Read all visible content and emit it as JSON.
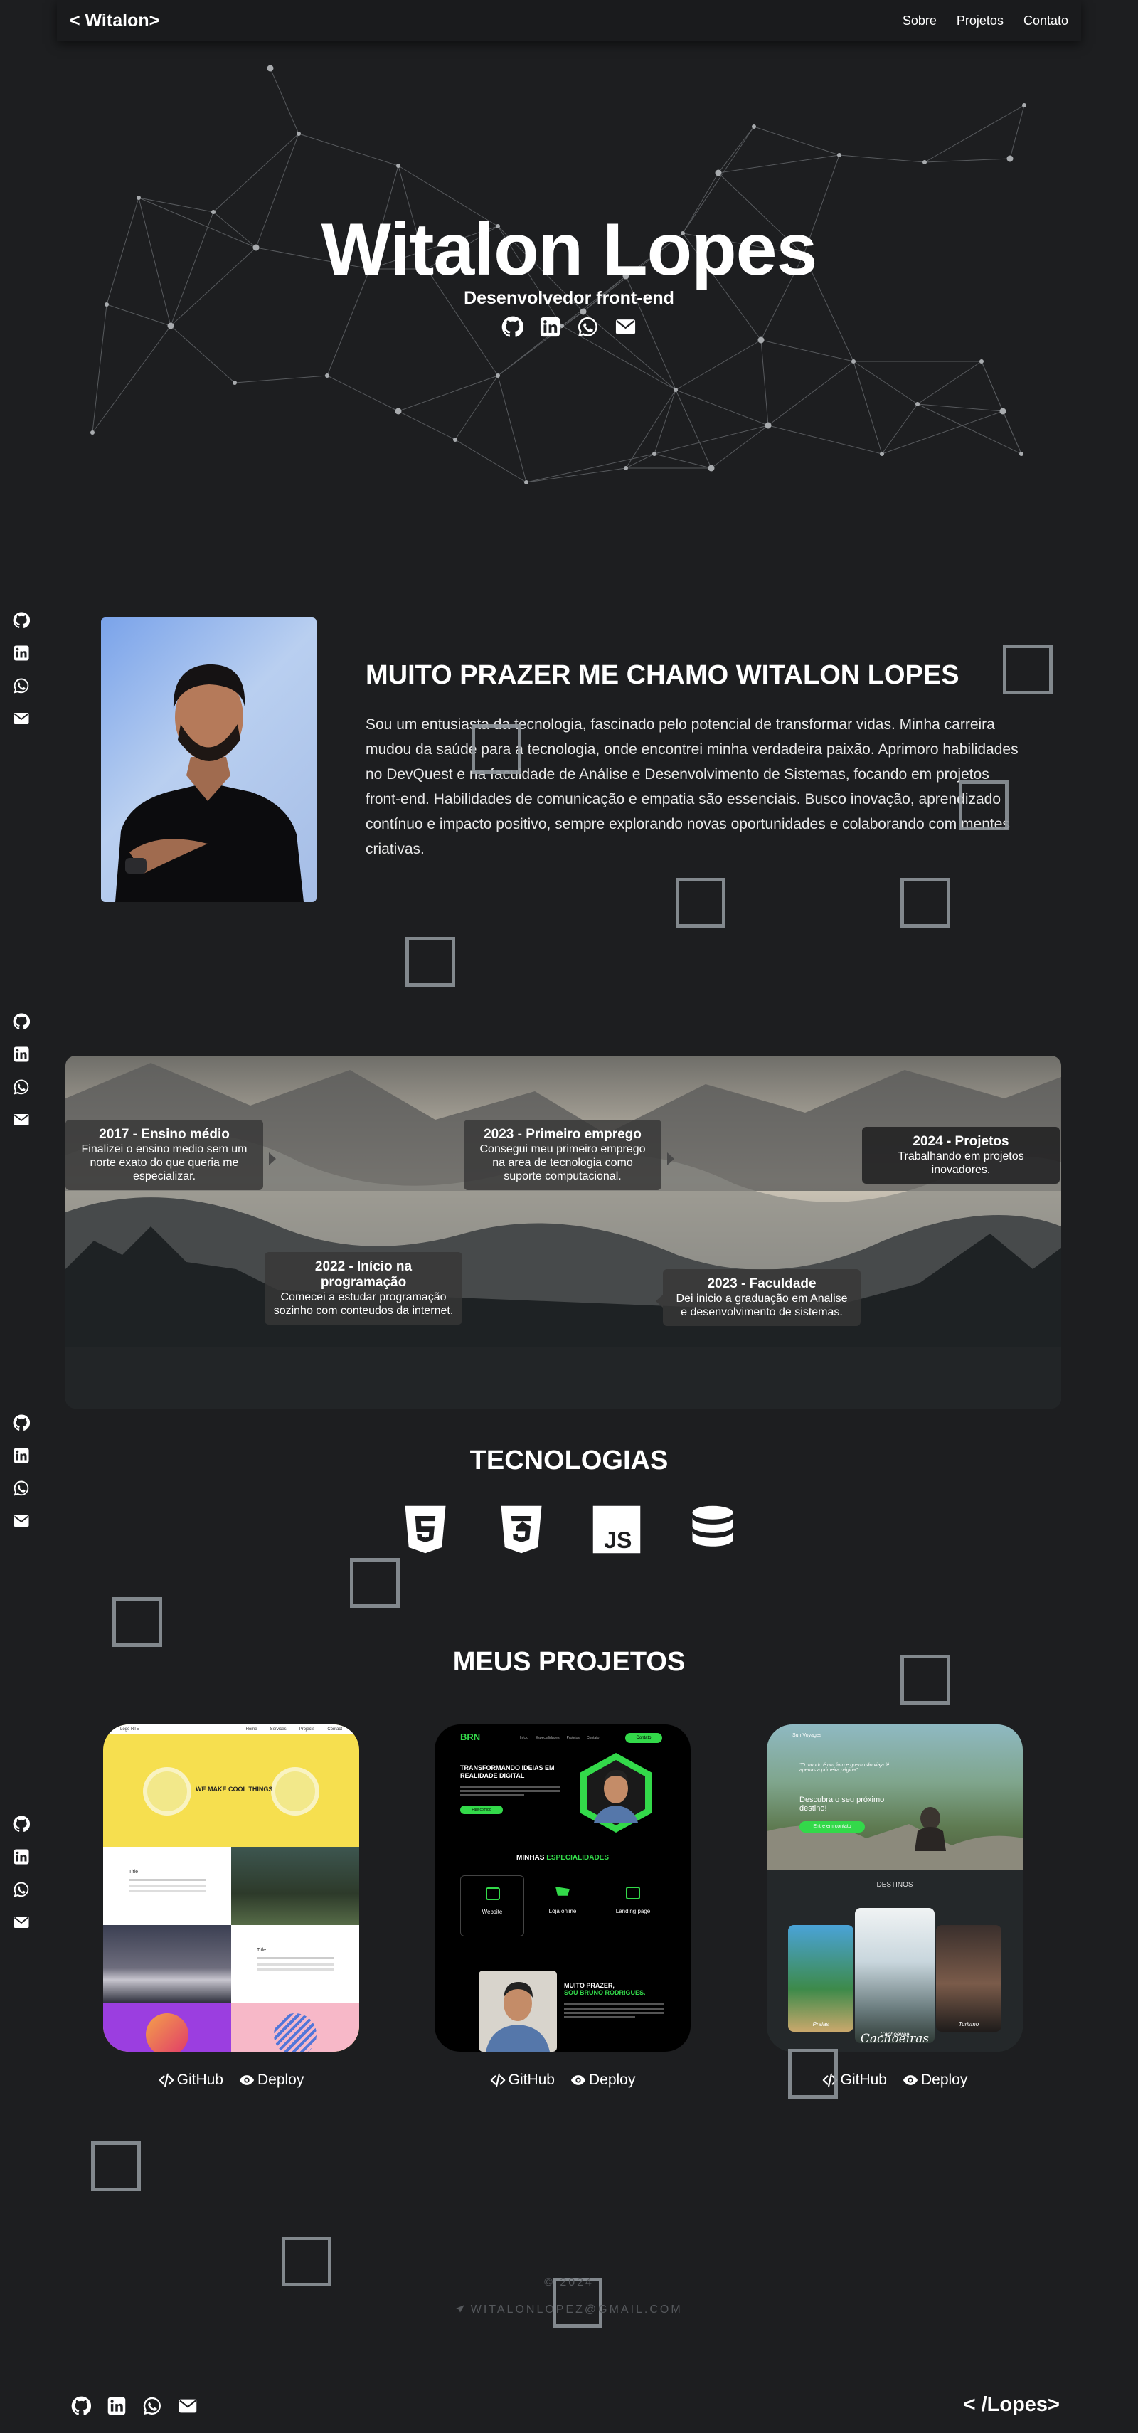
{
  "nav": {
    "brand": "< Witalon>",
    "links": [
      "Sobre",
      "Projetos",
      "Contato"
    ]
  },
  "hero": {
    "name": "Witalon Lopes",
    "role": "Desenvolvedor front-end"
  },
  "about": {
    "title": "MUITO PRAZER ME CHAMO WITALON LOPES",
    "text": "Sou um entusiasta da tecnologia, fascinado pelo potencial de transformar vidas. Minha carreira mudou da saúde para a tecnologia, onde encontrei minha verdadeira paixão. Aprimoro habilidades no DevQuest e na faculdade de Análise e Desenvolvimento de Sistemas, focando em projetos front-end. Habilidades de comunicação e empatia são essenciais. Busco inovação, aprendizado contínuo e impacto positivo, sempre explorando novas oportunidades e colaborando com mentes criativas."
  },
  "timeline": [
    {
      "title": "2017 - Ensino médio",
      "desc": "Finalizei o ensino medio sem um norte exato do que queria me especializar."
    },
    {
      "title": "2022 - Início na programação",
      "desc": "Comecei a estudar programação sozinho com conteudos da internet."
    },
    {
      "title": "2023 - Primeiro emprego",
      "desc": "Consegui meu primeiro emprego na area de tecnologia como suporte computacional."
    },
    {
      "title": "2023 - Faculdade",
      "desc": "Dei inicio a graduação em Analise e desenvolvimento de sistemas."
    },
    {
      "title": "2024 - Projetos",
      "desc": "Trabalhando em projetos inovadores."
    }
  ],
  "tech": {
    "title": "TECNOLOGIAS",
    "icons": [
      "html5-icon",
      "css3-icon",
      "javascript-icon",
      "database-icon"
    ]
  },
  "projects": {
    "title": "MEUS PROJETOS",
    "github_label": "GitHub",
    "deploy_label": "Deploy",
    "items": [
      {
        "thumb_text": "WE MAKE COOL THINGS",
        "thumb_small": "Title",
        "thumb_brand": "Logo RTE",
        "thumb_nav": [
          "Home",
          "Services",
          "Projects",
          "Contact"
        ]
      },
      {
        "thumb_brand": "BRN",
        "thumb_heading": "TRANSFORMANDO IDEIAS EM REALIDADE DIGITAL",
        "thumb_nav": [
          "Início",
          "Especialidades",
          "Projetos",
          "Contato"
        ],
        "thumb_cta": "Contato",
        "thumb_button": "Fale comigo",
        "thumb_section_a": "MINHAS",
        "thumb_section_b": "ESPECIALIDADES",
        "thumb_cards": [
          "Website",
          "Loja online",
          "Landing page"
        ],
        "thumb_bio_a": "MUITO PRAZER,",
        "thumb_bio_b": "SOU BRUNO RODRIGUES."
      },
      {
        "thumb_brand": "Sun Voyages",
        "thumb_quote": "\"O mundo é um livro e quem não viaja lê apenas a primeira página\"",
        "thumb_heading": "Descubra o seu próximo destino!",
        "thumb_button": "Entre em contato",
        "thumb_section": "DESTINOS",
        "thumb_captions": [
          "Praias",
          "Cachoeiras",
          "Turismo"
        ],
        "thumb_big": "Cachoeiras"
      }
    ]
  },
  "footer": {
    "copyright": "© 2024",
    "email": "WITALONLOPEZ@GMAIL.COM",
    "brand": "< /Lopes>"
  }
}
